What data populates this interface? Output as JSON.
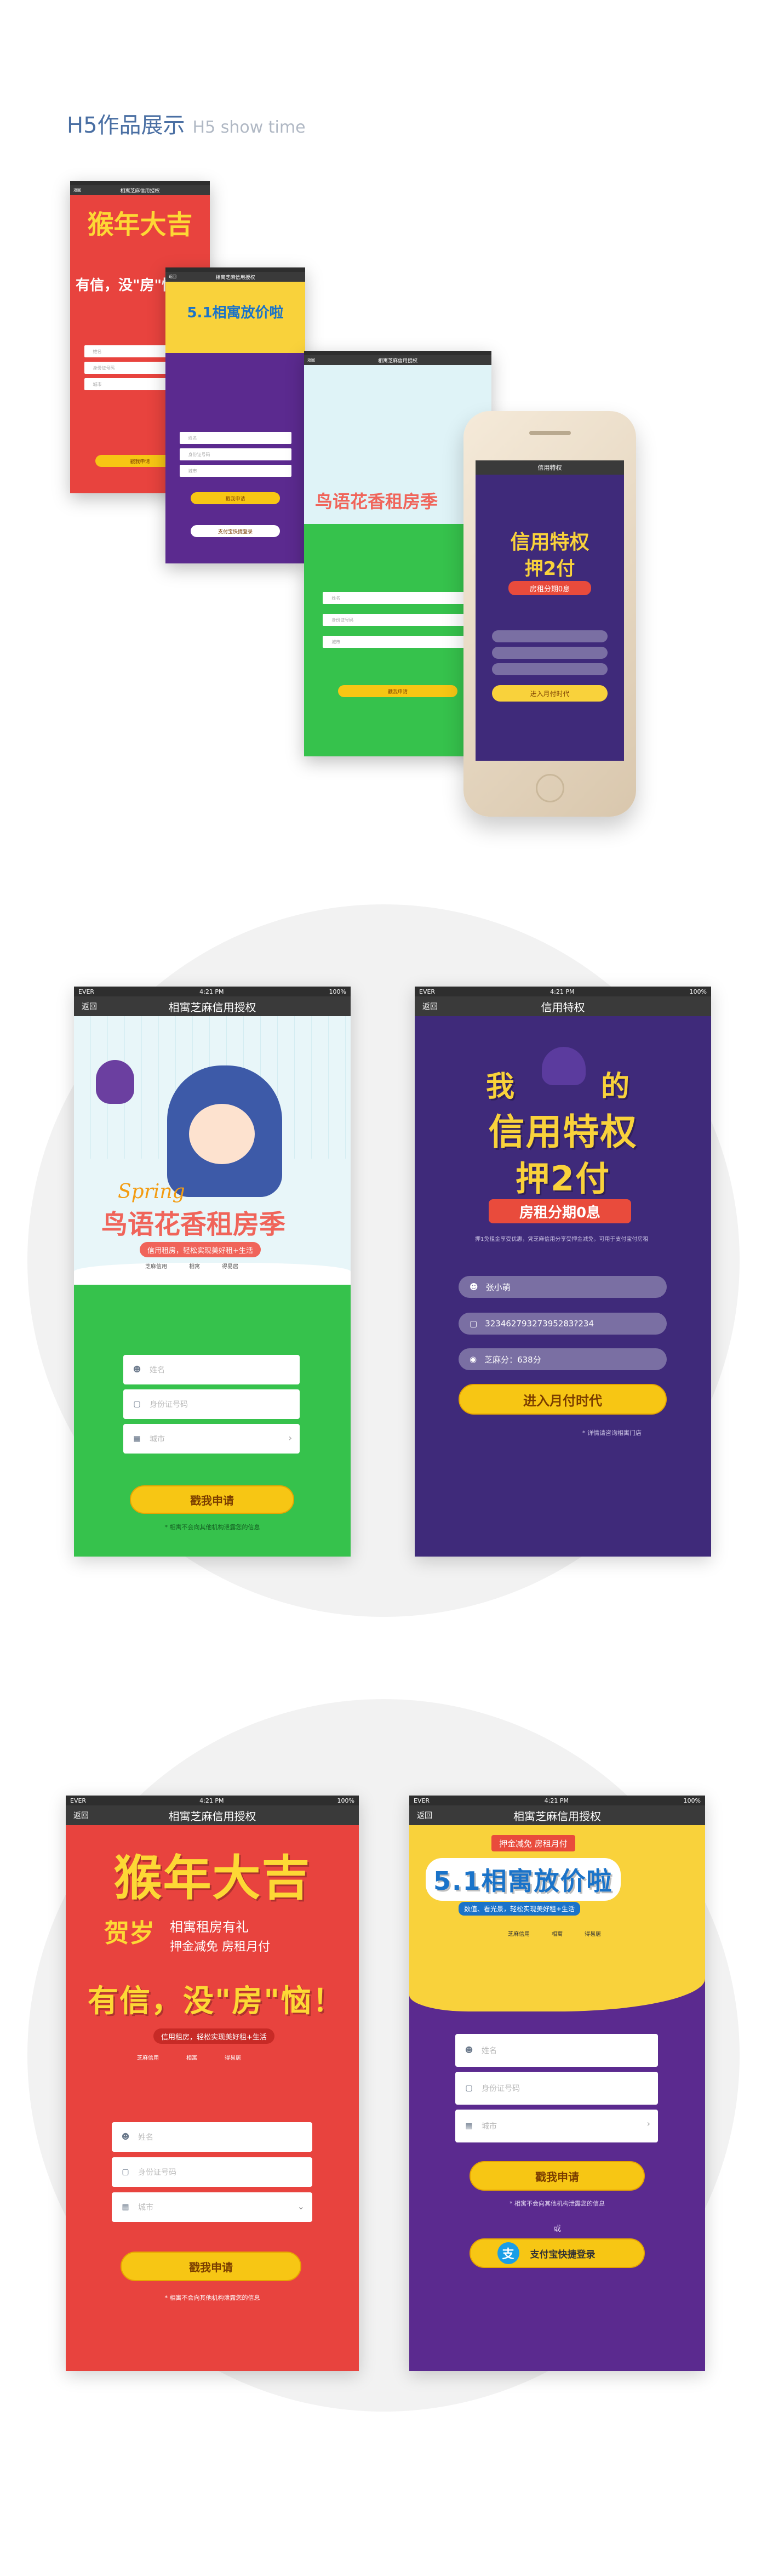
{
  "header": {
    "title": "H5作品展示",
    "subtitle": "H5 show time"
  },
  "status": {
    "carrier": "EVER",
    "time": "4:21 PM",
    "battery": "100%"
  },
  "nav": {
    "back": "返回",
    "title_zhima": "相寓芝麻信用授权",
    "title_credit": "信用特权"
  },
  "form": {
    "name": "姓名",
    "id": "身份证号码",
    "city": "城市",
    "apply": "戳我申请",
    "disclaimer": "* 相寓不会向其他机构泄露您的信息",
    "or": "或",
    "alipay": "支付宝快捷登录"
  },
  "spring": {
    "en": "Spring",
    "cn": "鸟语花香租房季",
    "tagline": "信用租房，轻松实现美好租+生活",
    "brands": [
      "芝麻信用",
      "相寓",
      "得易居"
    ]
  },
  "credit": {
    "line1_a": "我",
    "line1_b": "的",
    "line2": "信用特权",
    "line3": "押2付",
    "badge": "房租分期0息",
    "promo": "押1免租金享受优惠，凭芝麻信用分享受押金减免，可用于支付宝付房租",
    "user_name": "张小萌",
    "user_id": "32346279327395283?234",
    "score_label": "芝麻分：638分",
    "cta": "进入月付时代",
    "footnote": "* 详情请咨询相寓门店"
  },
  "monkey": {
    "headline": "猴年大吉",
    "left_chars": "贺岁",
    "sub1": "相寓租房有礼",
    "sub2": "押金减免 房租月付",
    "slogan": "有信，没\"房\"恼！",
    "tagline": "信用租房，轻松实现美好租+生活",
    "icons": [
      "芝麻信用",
      "相寓",
      "得易居"
    ]
  },
  "may": {
    "banner_top": "押金减免 房租月付",
    "headline": "5.1相寓放价啦",
    "sub": "数值、看光景，轻松实现美好租+生活",
    "stars": [
      "芝麻信用",
      "相寓",
      "得易居"
    ]
  },
  "colors": {
    "green": "#36c24c",
    "purple": "#3f2a7a",
    "red": "#e8433e",
    "violet": "#5b2a8f",
    "yellow": "#f7c614",
    "navy": "#4a6fa3"
  }
}
